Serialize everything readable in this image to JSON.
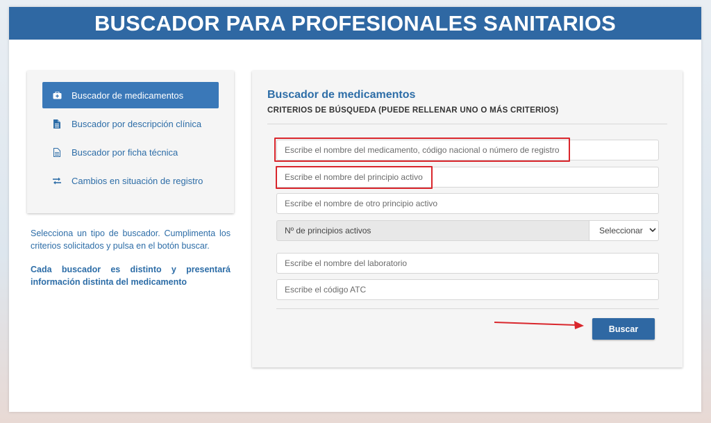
{
  "banner": {
    "title": "BUSCADOR PARA PROFESIONALES SANITARIOS"
  },
  "sidebar": {
    "items": [
      {
        "label": "Buscador de medicamentos",
        "icon": "briefcase-medical-icon",
        "active": true
      },
      {
        "label": "Buscador por descripción clínica",
        "icon": "file-icon",
        "active": false
      },
      {
        "label": "Buscador por ficha técnica",
        "icon": "file-text-icon",
        "active": false
      },
      {
        "label": "Cambios en situación de registro",
        "icon": "exchange-arrows-icon",
        "active": false
      }
    ]
  },
  "info": {
    "line1": "Selecciona un tipo de buscador. Cumplimenta los criterios solicitados y pulsa en el botón buscar.",
    "line2": "Cada buscador es distinto y presentará información distinta del medicamento"
  },
  "panel": {
    "title": "Buscador de medicamentos",
    "subtitle": "CRITERIOS DE BÚSQUEDA (PUEDE RELLENAR UNO O MÁS CRITERIOS)",
    "fields": {
      "medicamento_placeholder": "Escribe el nombre del medicamento, código nacional o número de registro",
      "principio_placeholder": "Escribe el nombre del principio activo",
      "otro_principio_placeholder": "Escribe el nombre de otro principio activo",
      "laboratorio_placeholder": "Escribe el nombre del laboratorio",
      "atc_placeholder": "Escribe el código ATC"
    },
    "count": {
      "label": "Nº de principios activos",
      "selected": "Seleccionar"
    },
    "search_button": "Buscar"
  },
  "colors": {
    "brand": "#2f68a3",
    "highlight": "#d9262c",
    "link": "#2d6da7"
  }
}
